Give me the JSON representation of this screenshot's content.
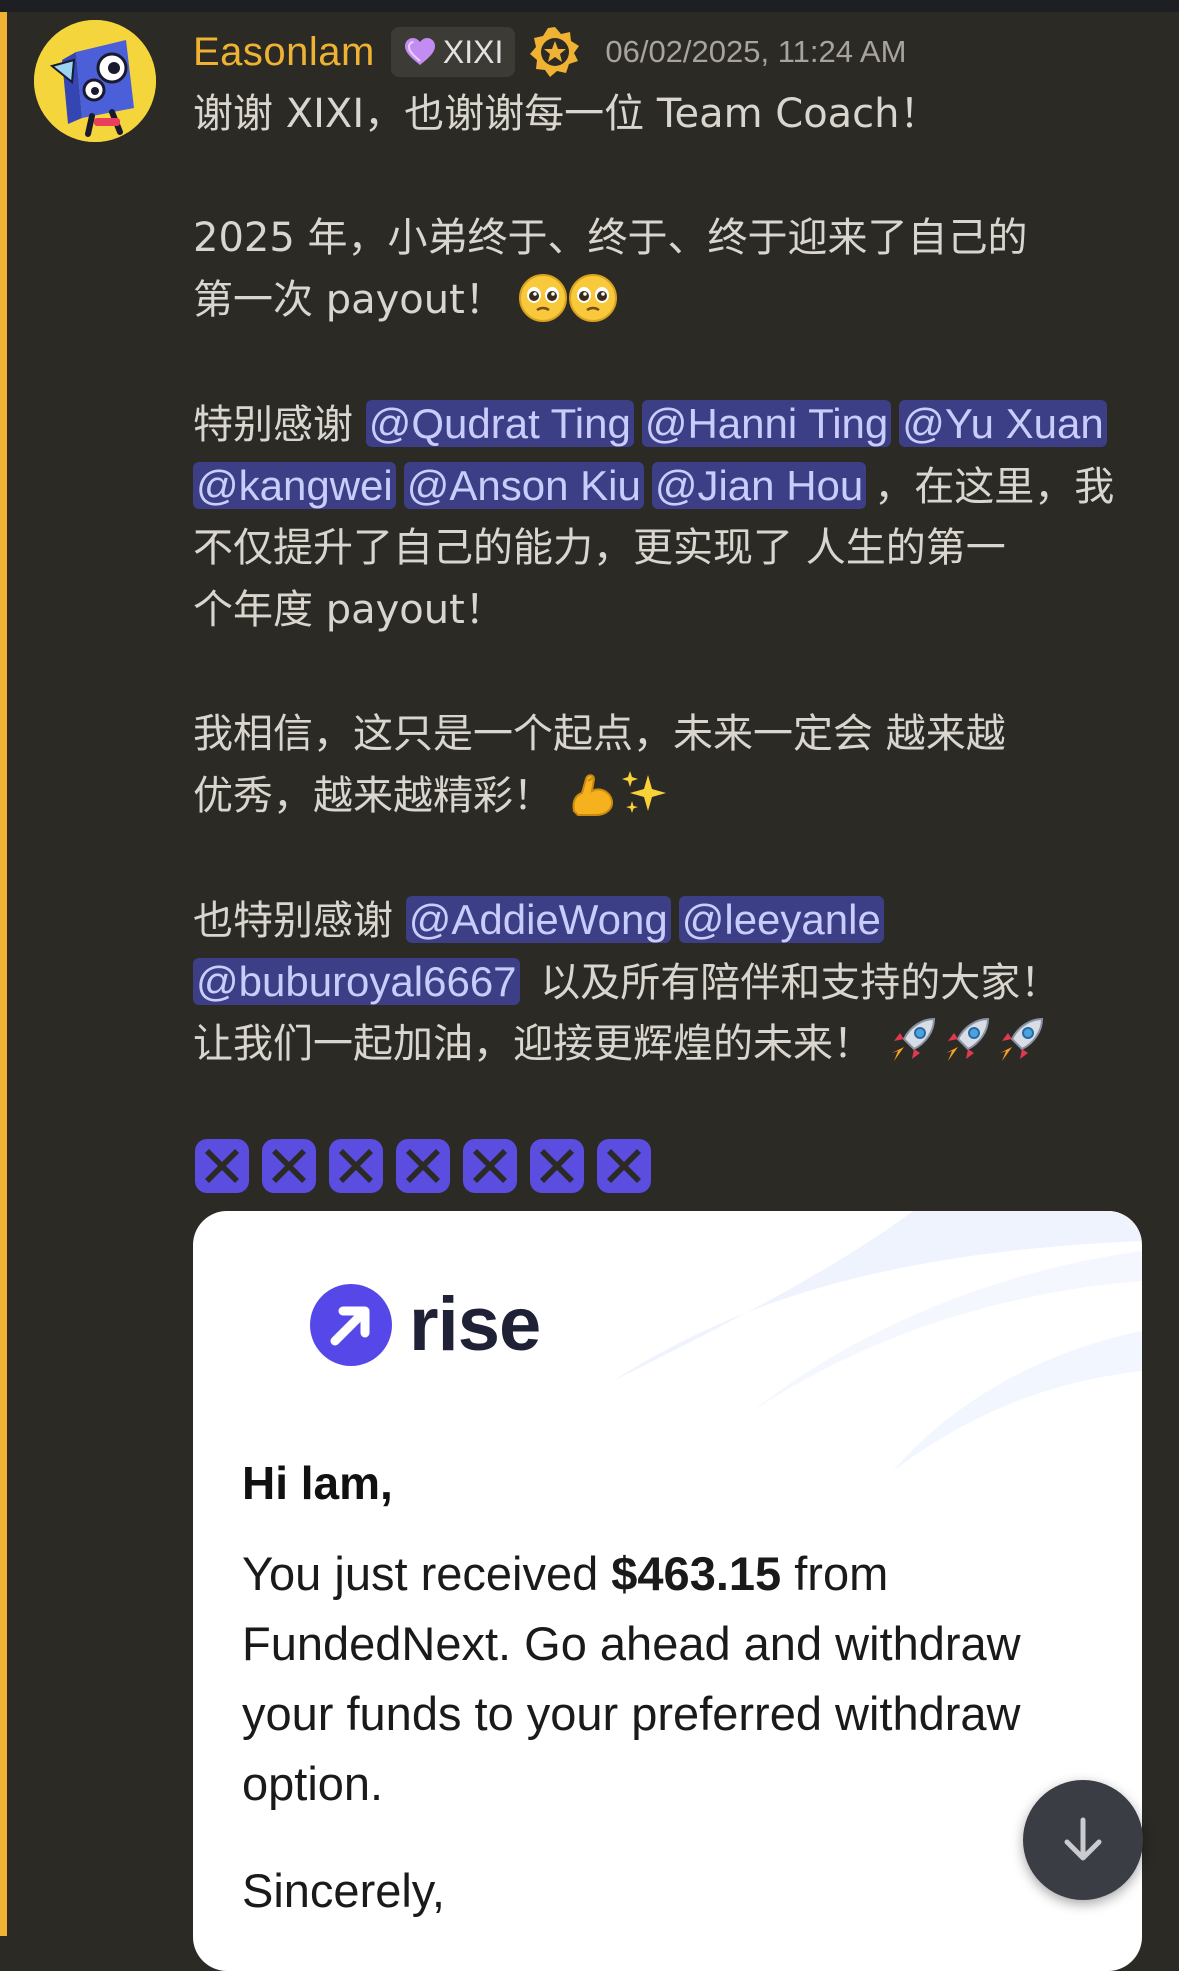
{
  "author": {
    "username": "Easonlam",
    "role_tag": "XIXI",
    "timestamp": "06/02/2025, 11:24 AM"
  },
  "message": {
    "l1": "谢谢 XIXI，也谢谢每一位 Team Coach！",
    "l2": "2025 年，小弟终于、终于、终于迎来了自己的",
    "l3": "第一次 payout！",
    "l4_pre": "特别感谢 ",
    "l4_m1": "@Qudrat Ting",
    "l4_m2": "@Hanni Ting",
    "l4_m3": "@Yu Xuan",
    "l5_m1": "@kangwei",
    "l5_m2": "@Anson Kiu",
    "l5_m3": "@Jian Hou",
    "l5_post": "，在这里，我",
    "l6": "不仅提升了自己的能力，更实现了 人生的第一",
    "l7": "个年度 payout！",
    "l8": "我相信，这只是一个起点，未来一定会 越来越",
    "l9": "优秀，越来越精彩！",
    "l10_pre": "也特别感谢 ",
    "l10_m1": "@AddieWong",
    "l10_m2": "@leeyanle",
    "l11_m1": "@buburoyal6667",
    "l11_post": " 以及所有陪伴和支持的大家！",
    "l12": "让我们一起加油，迎接更辉煌的未来！"
  },
  "embed": {
    "logo_text": "rise",
    "greeting": "Hi lam,",
    "body_1_pre": "You just received ",
    "body_1_amount": "$463.15",
    "body_1_post": " from",
    "body_2": "FundedNext. Go ahead and withdraw",
    "body_3": "your funds to your preferred withdraw",
    "body_4": "option.",
    "sign_off": "Sincerely,"
  },
  "colors": {
    "background": "#2c2a24",
    "username": "#f0b232",
    "mention_bg": "#3c3f86",
    "mention_text": "#c9cdfb",
    "cross_emote": "#5b4de0"
  },
  "icons": {
    "role": "purple-heart-icon",
    "badge": "gold-star-badge-icon",
    "reactions": [
      "pleading-face",
      "flexed-biceps",
      "sparkles",
      "rocket",
      "cross-emote"
    ],
    "scroll": "arrow-down-icon"
  }
}
